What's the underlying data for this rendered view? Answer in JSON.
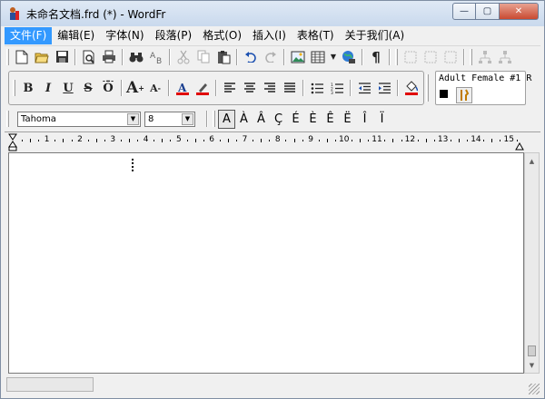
{
  "window": {
    "title": "未命名文档.frd (*) - WordFr",
    "controls": {
      "minimize": "—",
      "maximize": "▢",
      "close": "✕"
    }
  },
  "menu": {
    "items": [
      {
        "label": "文件(F)",
        "active": true
      },
      {
        "label": "编辑(E)"
      },
      {
        "label": "字体(N)"
      },
      {
        "label": "段落(P)"
      },
      {
        "label": "格式(O)"
      },
      {
        "label": "插入(I)"
      },
      {
        "label": "表格(T)"
      },
      {
        "label": "关于我们(A)"
      }
    ]
  },
  "toolbar_format": {
    "bold": "B",
    "italic": "I",
    "underline": "U",
    "strike": "S",
    "overline": "Ō",
    "grow_font": "A",
    "shrink_font": "A",
    "pilcrow": "¶"
  },
  "voice": {
    "name": "Adult Female #1 R"
  },
  "font": {
    "family": "Tahoma",
    "size": "8",
    "dropdown_arrow": "▼"
  },
  "accent_chars": [
    "A",
    "À",
    "Â",
    "Ç",
    "É",
    "È",
    "Ê",
    "Ë",
    "Î",
    "Ï"
  ],
  "ruler": {
    "numbers": [
      "1",
      "2",
      "3",
      "4",
      "5",
      "6",
      "7",
      "8",
      "9",
      "10",
      "11",
      "12",
      "13",
      "14",
      "15"
    ]
  },
  "scrollbar": {
    "up": "▲",
    "down": "▼"
  },
  "colors": {
    "menu_active": "#3399ff",
    "font_color": "#e00000",
    "highlight": "#e00000"
  }
}
